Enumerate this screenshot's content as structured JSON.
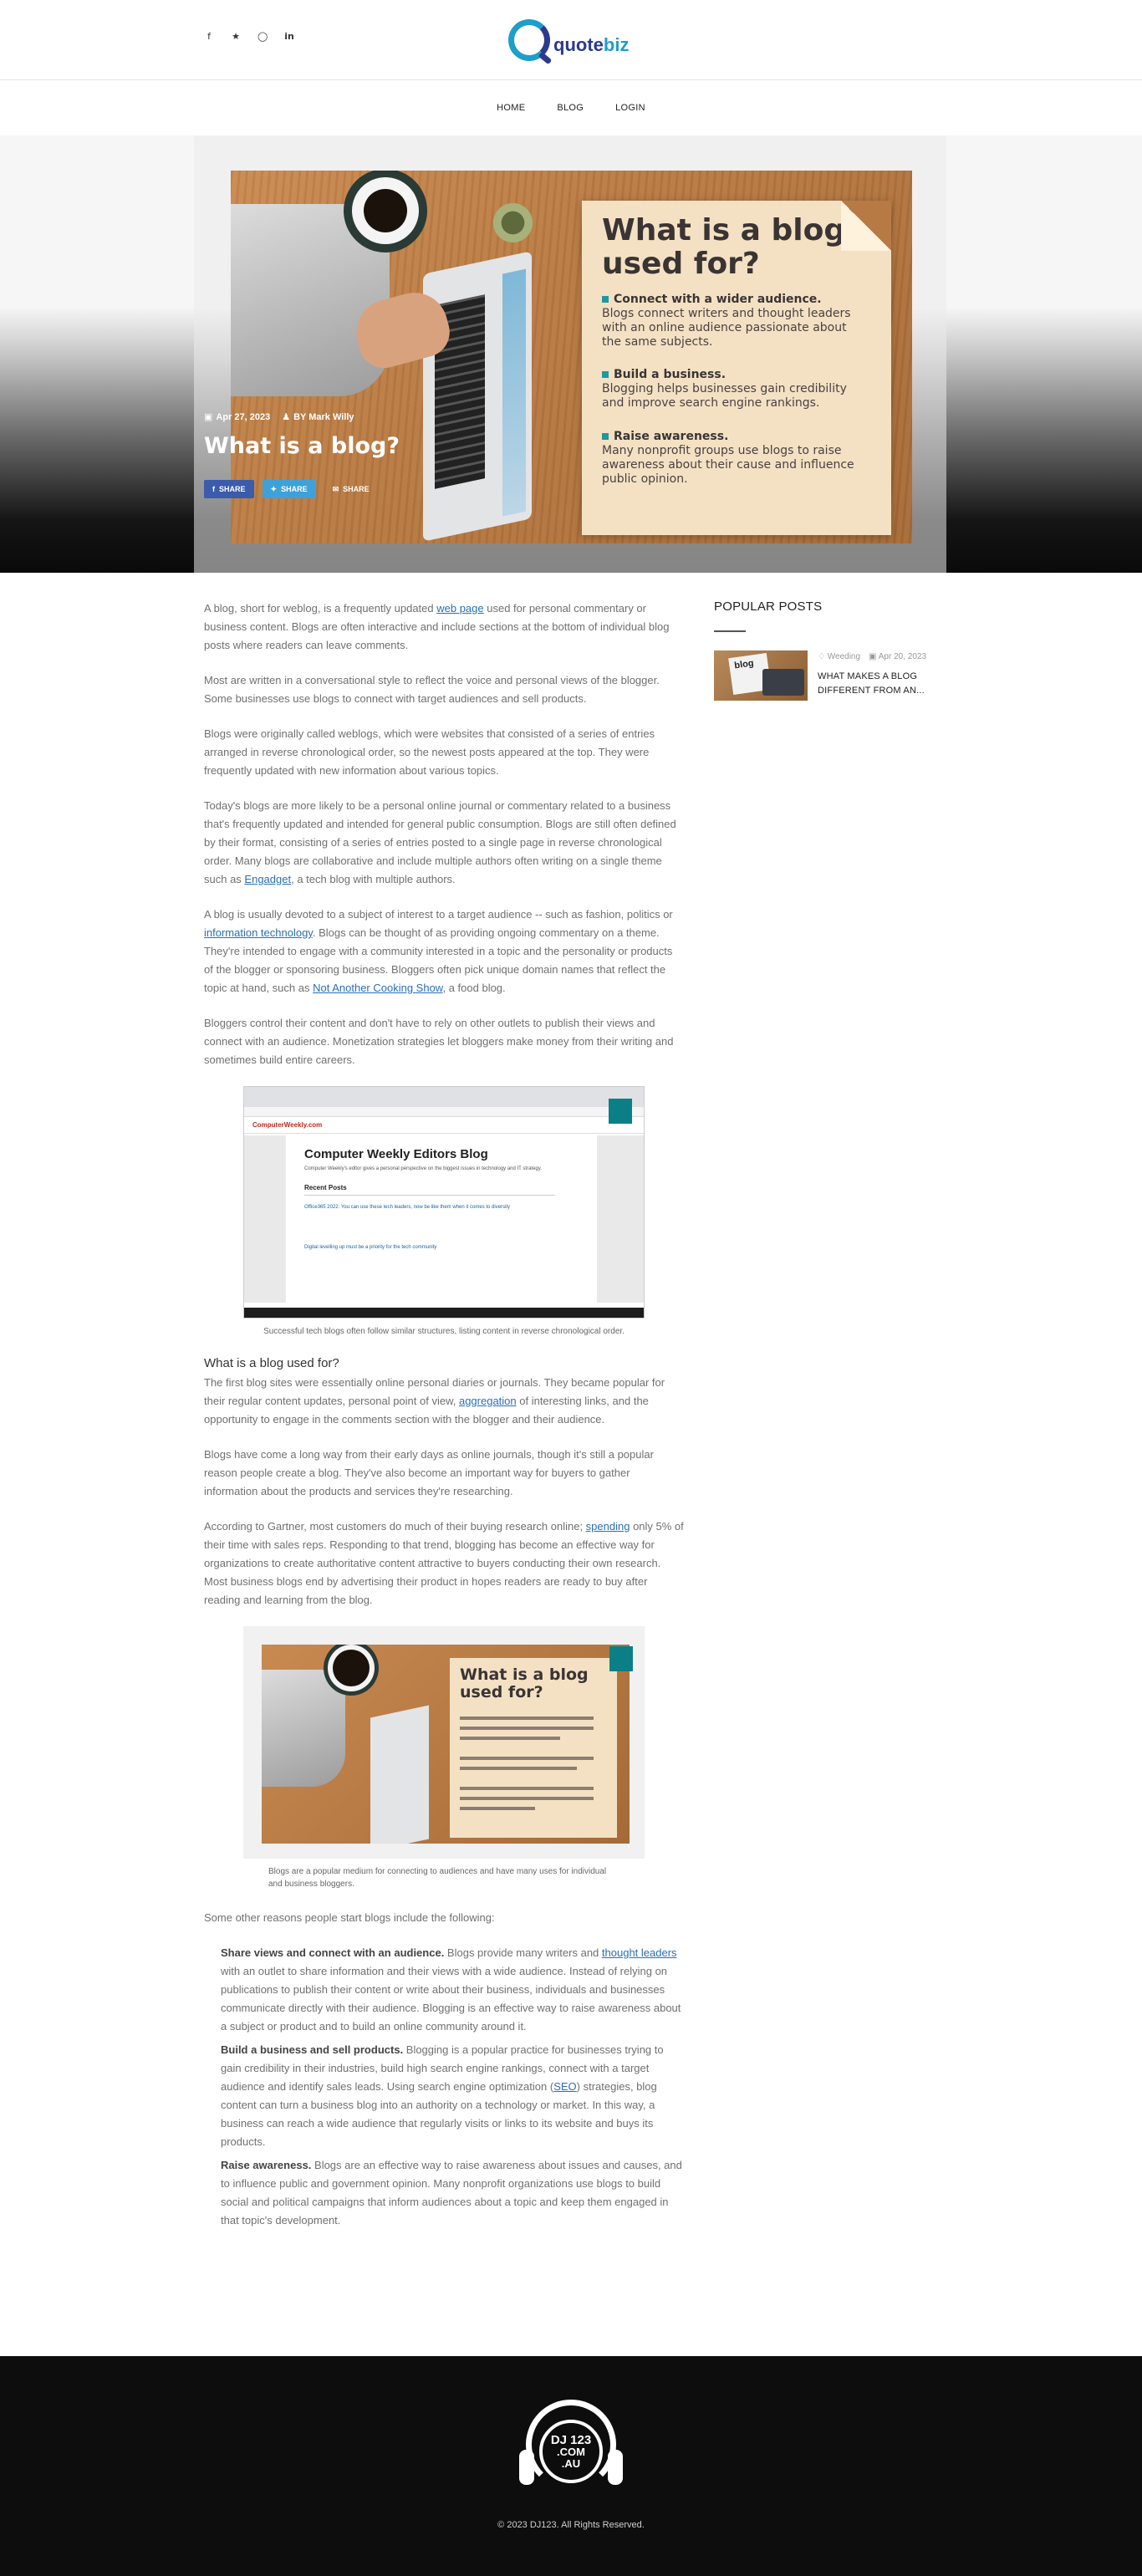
{
  "header": {
    "social_icons": [
      "facebook-icon",
      "twitter-icon",
      "instagram-icon",
      "linkedin-icon"
    ],
    "logo_text_dark": "quote",
    "logo_text_light": "biz",
    "colors": {
      "logo_blue": "#1f9ec9",
      "logo_navy": "#2d3a8c"
    }
  },
  "nav": {
    "items": [
      "HOME",
      "BLOG",
      "LOGIN"
    ]
  },
  "hero": {
    "date": "Apr 27, 2023",
    "author": "BY Mark Willy",
    "title": "What is a blog?",
    "share_facebook": "SHARE",
    "share_twitter": "SHARE",
    "share_email": "SHARE",
    "image": {
      "heading": "What is a blog used for?",
      "points": [
        {
          "title": "Connect with a wider audience.",
          "text": "Blogs connect writers and thought leaders with an online audience passionate about the same subjects."
        },
        {
          "title": "Build a business.",
          "text": "Blogging helps businesses gain credibility and improve search engine rankings."
        },
        {
          "title": "Raise awareness.",
          "text": "Many nonprofit groups use blogs to raise awareness about their cause and influence public opinion."
        }
      ]
    }
  },
  "article": {
    "p1_a": "A blog, short for weblog, is a frequently updated ",
    "p1_link": "web page",
    "p1_b": " used for personal commentary or business content. Blogs are often interactive and include sections at the bottom of individual blog posts where readers can leave comments.",
    "p2": "Most are written in a conversational style to reflect the voice and personal views of the blogger. Some businesses use blogs to connect with target audiences and sell products.",
    "p3": "Blogs were originally called weblogs, which were websites that consisted of a series of entries arranged in reverse chronological order, so the newest posts appeared at the top. They were frequently updated with new information about various topics.",
    "p4_a": "Today's blogs are more likely to be a personal online journal or commentary related to a business that's frequently updated and intended for general public consumption. Blogs are still often defined by their format, consisting of a series of entries posted to a single page in reverse chronological order. Many blogs are collaborative and include multiple authors often writing on a single theme such as ",
    "p4_link": "Engadget",
    "p4_b": ", a tech blog with multiple authors.",
    "p5_a": "A blog is usually devoted to a subject of interest to a target audience -- such as fashion, politics or ",
    "p5_link1": "information technology",
    "p5_b": ". Blogs can be thought of as providing ongoing commentary on a theme. They're intended to engage with a community interested in a topic and the personality or products of the blogger or sponsoring business. Bloggers often pick unique domain names that reflect the topic at hand, such as ",
    "p5_link2": "Not Another Cooking Show",
    "p5_c": ", a food blog.",
    "p6": "Bloggers control their content and don't have to rely on other outlets to publish their views and connect with an audience. Monetization strategies let bloggers make money from their writing and sometimes build entire careers.",
    "fig1": {
      "site_logo": "ComputerWeekly.com",
      "title": "Computer Weekly Editors Blog",
      "subtitle": "Computer Weekly's editor gives a personal perspective on the biggest issues in technology and IT strategy.",
      "recent": "Recent Posts",
      "item1": "Office365 2022: You can use these tech leaders, now be like them when it comes to diversity",
      "item2": "Digital levelling up must be a priority for the tech community",
      "caption": "Successful tech blogs often follow similar structures, listing content in reverse chronological order."
    },
    "h_used_for": "What is a blog used for?",
    "p7_a": "The first blog sites were essentially online personal diaries or journals. They became popular for their regular content updates, personal point of view, ",
    "p7_link": "aggregation",
    "p7_b": " of interesting links, and the opportunity to engage in the comments section with the blogger and their audience.",
    "p8": "Blogs have come a long way from their early days as online journals, though it's still a popular reason people create a blog. They've also become an important way for buyers to gather information about the products and services they're researching.",
    "p9_a": "According to Gartner, most customers do much of their buying research online; ",
    "p9_link": "spending",
    "p9_b": " only 5% of their time with sales reps. Responding to that trend, blogging has become an effective way for organizations to create authoritative content attractive to buyers conducting their own research. Most business blogs end by advertising their product in hopes readers are ready to buy after reading and learning from the blog.",
    "fig2": {
      "heading": "What is a blog used for?",
      "caption": "Blogs are a popular medium for connecting to audiences and have many uses for individual and business bloggers."
    },
    "p10": "Some other reasons people start blogs include the following:",
    "r1_title": "Share views and connect with an audience.",
    "r1_a": " Blogs provide many writers and ",
    "r1_link": "thought leaders",
    "r1_b": " with an outlet to share information and their views with a wide audience. Instead of relying on publications to publish their content or write about their business, individuals and businesses communicate directly with their audience. Blogging is an effective way to raise awareness about a subject or product and to build an online community around it.",
    "r2_title": "Build a business and sell products.",
    "r2_a": " Blogging is a popular practice for businesses trying to gain credibility in their industries, build high search engine rankings, connect with a target audience and identify sales leads. Using search engine optimization (",
    "r2_link": "SEO",
    "r2_b": ") strategies, blog content can turn a business blog into an authority on a technology or market. In this way, a business can reach a wide audience that regularly visits or links to its website and buys its products.",
    "r3_title": "Raise awareness.",
    "r3_a": " Blogs are an effective way to raise awareness about issues and causes, and to influence public and government opinion. Many nonprofit organizations use blogs to build social and political campaigns that inform audiences about a topic and keep them engaged in that topic's development."
  },
  "sidebar": {
    "title": "POPULAR POSTS",
    "posts": [
      {
        "thumb_word": "blog",
        "category": "Weeding",
        "date": "Apr 20, 2023",
        "title": "WHAT MAKES A BLOG DIFFERENT FROM AN..."
      }
    ]
  },
  "footer": {
    "logo_line1": "DJ 123",
    "logo_line2": ".COM",
    "logo_line3": ".AU",
    "copyright": "© 2023 DJ123. All Rights Reserved."
  }
}
